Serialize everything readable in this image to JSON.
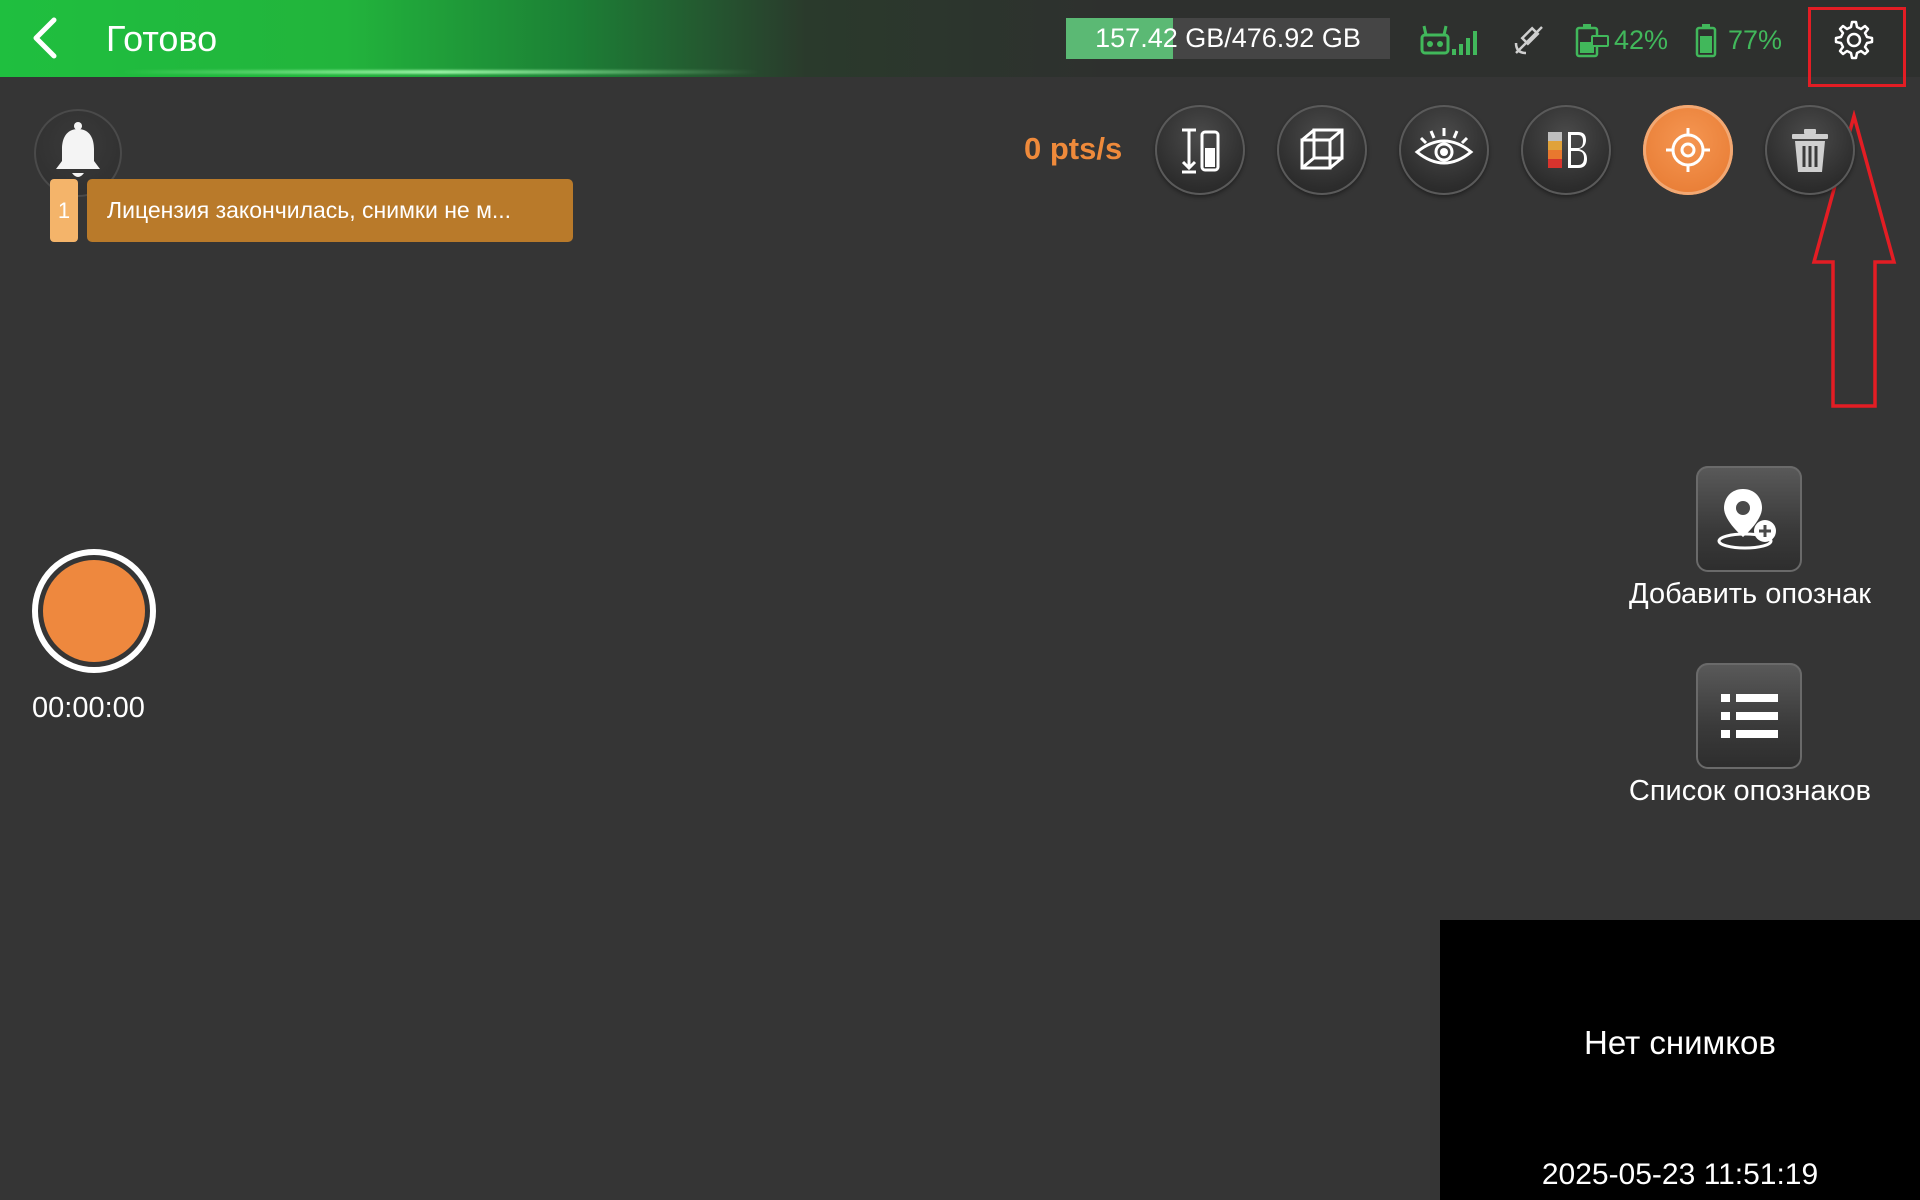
{
  "header": {
    "back_icon": "chevron-left-icon",
    "title": "Готово",
    "storage_text": "157.42 GB/476.92 GB",
    "storage_used_fraction": 0.33,
    "storage_color": "#5bb974",
    "status": {
      "controller_icon": "remote-controller-signal-icon",
      "satellite_icon": "satellite-off-icon",
      "device_battery_icon": "device-battery-icon",
      "device_battery": "42%",
      "battery_icon": "battery-icon",
      "battery": "77%",
      "status_color": "#41b85b"
    },
    "settings_icon": "gear-icon",
    "highlight_color": "#e31d24"
  },
  "notifications": {
    "bell_icon": "bell-icon",
    "count": "1",
    "message": "Лицензия закончилась, снимки не м..."
  },
  "toolbar": {
    "rate": "0 pts/s",
    "rate_color": "#ef8a3b",
    "tools": [
      {
        "icon": "height-adjust-icon"
      },
      {
        "icon": "cube-view-icon"
      },
      {
        "icon": "eye-view-icon"
      },
      {
        "icon": "color-mode-icon"
      },
      {
        "icon": "target-locate-icon",
        "active": true
      },
      {
        "icon": "trash-icon"
      }
    ],
    "accent": "#e5772e"
  },
  "recording": {
    "record_icon": "record-icon",
    "time": "00:00:00",
    "color": "#ee883e"
  },
  "side_actions": {
    "add_marker": {
      "icon": "add-marker-pin-icon",
      "label": "Добавить опознак"
    },
    "marker_list": {
      "icon": "list-icon",
      "label": "Список опознаков"
    }
  },
  "snapshots": {
    "empty_text": "Нет снимков",
    "timestamp": "2025-05-23 11:51:19"
  }
}
